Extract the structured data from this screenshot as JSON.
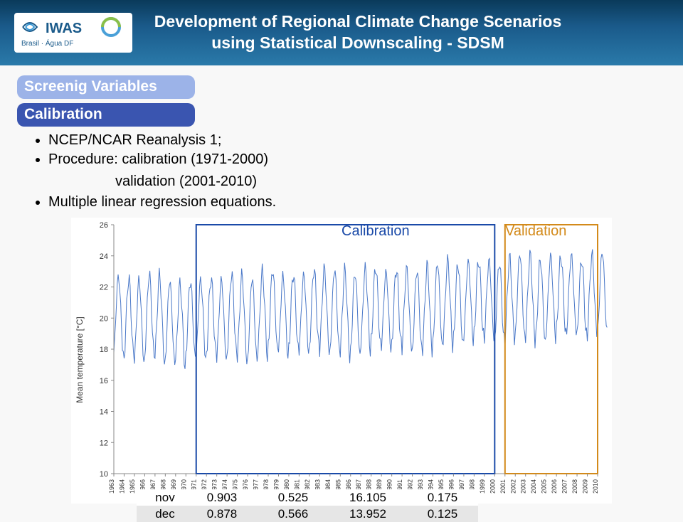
{
  "header": {
    "title_line1": "Development of Regional Climate Change Scenarios",
    "title_line2": "using Statistical Downscaling - SDSM",
    "logo_brand": "IWAS",
    "logo_sub": "Brasil · Água DF"
  },
  "tags": {
    "screening": "Screenig Variables",
    "calibration": "Calibration"
  },
  "bullets": {
    "b1": "NCEP/NCAR Reanalysis 1;",
    "b2a": "Procedure: calibration (1971-2000)",
    "b2b": "validation (2001-2010)",
    "b3": "Multiple linear regression equations."
  },
  "chart_labels": {
    "calibration": "Calibration",
    "validation": "Validation",
    "ylabel": "Mean temperature [°C]"
  },
  "table": {
    "rows": [
      {
        "m": "nov",
        "a": "0.903",
        "b": "0.525",
        "c": "16.105",
        "d": "0.175"
      },
      {
        "m": "dec",
        "a": "0.878",
        "b": "0.566",
        "c": "13.952",
        "d": "0.125"
      }
    ]
  },
  "chart_data": {
    "type": "line",
    "title": "",
    "xlabel": "",
    "ylabel": "Mean temperature [°C]",
    "ylim": [
      10,
      26
    ],
    "y_ticks": [
      10,
      12,
      14,
      16,
      18,
      20,
      22,
      24,
      26
    ],
    "x_categories_years": [
      1963,
      1964,
      1965,
      1966,
      1967,
      1968,
      1969,
      1970,
      1971,
      1972,
      1973,
      1974,
      1975,
      1976,
      1977,
      1978,
      1979,
      1980,
      1981,
      1982,
      1983,
      1984,
      1985,
      1986,
      1987,
      1988,
      1989,
      1990,
      1991,
      1992,
      1993,
      1994,
      1995,
      1996,
      1997,
      1998,
      1999,
      2000,
      2001,
      2002,
      2003,
      2004,
      2005,
      2006,
      2007,
      2008,
      2009,
      2010
    ],
    "resolution": "monthly",
    "series": [
      {
        "name": "Mean temperature",
        "values_estimated_monthly_range": "≈16–25°C oscillating seasonally",
        "values_yearly_approx_mean": [
          20.2,
          20.0,
          19.8,
          20.1,
          20.0,
          19.7,
          19.6,
          19.9,
          20.0,
          20.1,
          19.9,
          20.2,
          20.0,
          19.8,
          20.3,
          20.5,
          20.2,
          20.4,
          20.3,
          20.6,
          20.5,
          20.4,
          20.3,
          20.2,
          20.6,
          20.8,
          20.5,
          20.7,
          20.6,
          20.4,
          20.6,
          20.8,
          21.0,
          20.9,
          21.1,
          21.3,
          21.2,
          21.0,
          21.2,
          21.4,
          21.3,
          21.1,
          21.4,
          21.5,
          21.6,
          21.3,
          21.5,
          21.6
        ]
      }
    ],
    "annotations": [
      {
        "text": "Calibration",
        "box_x_range": [
          1971,
          2000
        ],
        "color": "#1a4aa8"
      },
      {
        "text": "Validation",
        "box_x_range": [
          2001,
          2010
        ],
        "color": "#d38a1a"
      }
    ],
    "grid": false,
    "legend": false
  }
}
